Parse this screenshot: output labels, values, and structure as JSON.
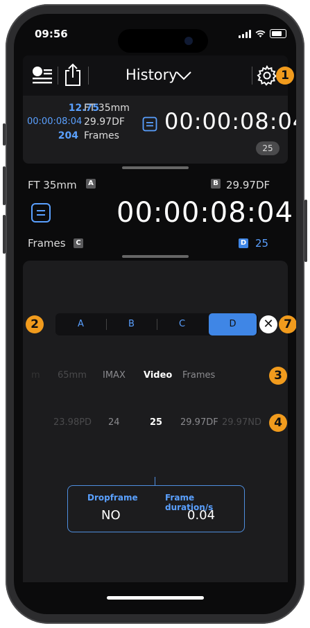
{
  "status_bar": {
    "time": "09:56"
  },
  "toolbar": {
    "title": "History"
  },
  "markers": {
    "one": "1",
    "two": "2",
    "three": "3",
    "four": "4",
    "seven": "7"
  },
  "history_card": {
    "row1_value": "12.75",
    "row1_unit": "FT 35mm",
    "row2_value": "00:00:08:04",
    "row2_unit": "29.97DF",
    "row3_value": "204",
    "row3_unit": "Frames",
    "timecode": "00:00:08:04",
    "badge": "25"
  },
  "converter": {
    "label_a_text": "FT 35mm",
    "label_a_letter": "A",
    "label_b_text": "29.97DF",
    "label_b_letter": "B",
    "label_c_text": "Frames",
    "label_c_letter": "C",
    "label_d_letter": "D",
    "label_d_value": "25",
    "timecode": "00:00:08:04"
  },
  "segment": {
    "items": [
      "A",
      "B",
      "C",
      "D"
    ],
    "selected": "D"
  },
  "format_picker": {
    "items": [
      "m",
      "65mm",
      "IMAX",
      "Video",
      "Frames"
    ],
    "selected": "Video"
  },
  "rate_picker": {
    "items": [
      "23.98PD",
      "24",
      "25",
      "29.97DF",
      "29.97ND"
    ],
    "selected": "25"
  },
  "info": {
    "dropframe_label": "Dropframe",
    "dropframe_value": "NO",
    "duration_label": "Frame duration/s",
    "duration_value": "0.04"
  },
  "colors": {
    "accent": "#3f86e6",
    "marker": "#f19b1d",
    "background": "#0b0b0c"
  }
}
